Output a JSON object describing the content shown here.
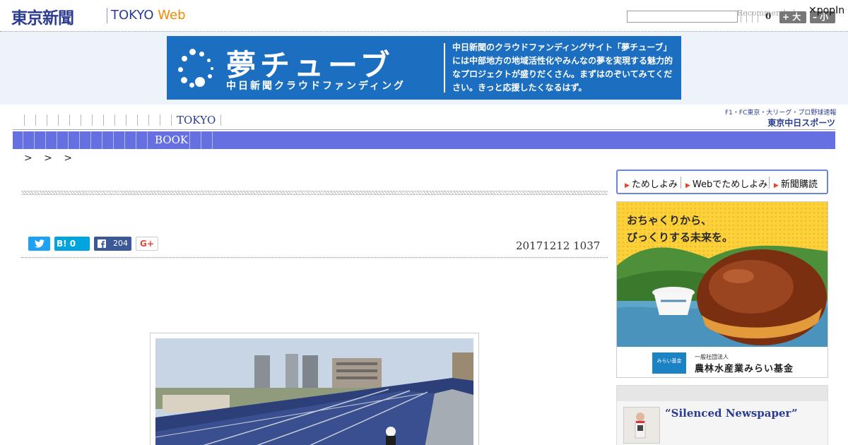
{
  "header": {
    "logo_jp": "東京新聞",
    "logo_en": "TOKYO",
    "logo_web": "Web",
    "recommend": "Recommended",
    "count": "0",
    "font_bigger": "+ 大",
    "font_smaller": "– 小",
    "popin": "popIn"
  },
  "banner": {
    "title": "夢チューブ",
    "subtitle": "中日新聞クラウドファンディング",
    "description": "中日新聞のクラウドファンディングサイト「夢チューブ」には中部地方の地域活性化やみんなの夢を実現する魅力的なプロジェクトが盛りだくさん。まずはのぞいてみてください。きっと応援したくなるはず。",
    "bg_color": "#1c6ec0"
  },
  "nav": {
    "tokyo": "TOKYO",
    "book": "BOOK",
    "chunichi_top": "F1・FC東京・大リーグ・プロ野球速報",
    "chunichi_main": "東京中日スポーツ",
    "accent_color": "#6670e0"
  },
  "breadcrumb": "> > >",
  "article": {
    "date": "20171212 1037",
    "share": {
      "hatena": "B! 0",
      "facebook_count": "204",
      "gplus": "G+"
    }
  },
  "sidebar": {
    "subscribe": {
      "item1": "ためしよみ",
      "item2": "Webでためしよみ",
      "item3": "新聞購読"
    },
    "ad": {
      "line1": "おちゃくりから、",
      "line2": "びっくりする未来を。",
      "logo_text": "みらい基金",
      "org_small": "一般社団法人",
      "org": "農林水産業みらい基金"
    },
    "recommend_title": "“Silenced Newspaper”"
  },
  "icons": {
    "twitter": "twitter-icon",
    "facebook": "facebook-icon",
    "close": "close-icon"
  }
}
